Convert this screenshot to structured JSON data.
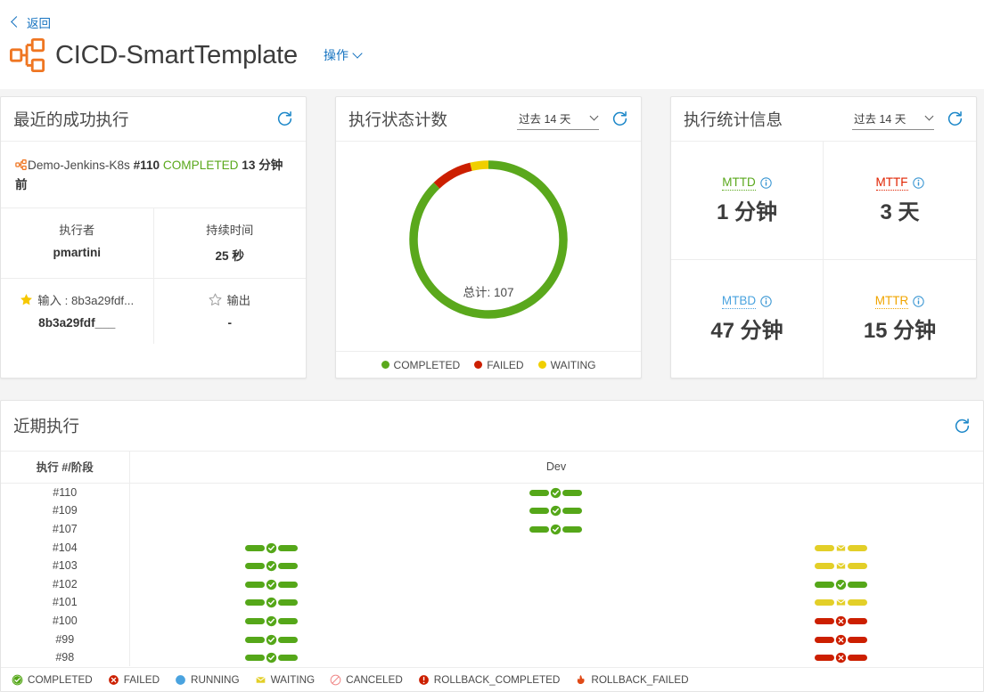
{
  "header": {
    "back_label": "返回",
    "title": "CICD-SmartTemplate",
    "actions_label": "操作",
    "logo_icon": "pipeline-template-icon"
  },
  "recent_success": {
    "title": "最近的成功执行",
    "refresh_icon": "refresh-icon",
    "pipeline_name": "Demo-Jenkins-K8s",
    "run_number": "#110",
    "status": "COMPLETED",
    "status_color": "#5aa81c",
    "time_ago": "13 分钟前",
    "executor_label": "执行者",
    "executor_value": "pmartini",
    "duration_label": "持续时间",
    "duration_value": "25 秒",
    "input_label": "输入 : 8b3a29fdf...",
    "input_value": "8b3a29fdf___",
    "input_icon": "star-filled-icon",
    "output_label": "输出",
    "output_value": "-",
    "output_icon": "star-outline-icon"
  },
  "status_counts": {
    "title": "执行状态计数",
    "range_value": "过去 14 天",
    "refresh_icon": "refresh-icon",
    "center_label": "总计: 107"
  },
  "chart_data": {
    "type": "pie",
    "title": "执行状态计数",
    "subtitle": "总计: 107",
    "total": 107,
    "categories": [
      "COMPLETED",
      "FAILED",
      "WAITING"
    ],
    "values": [
      94,
      9,
      4
    ],
    "colors": [
      "#5aa81c",
      "#cc1f00",
      "#f0cf00"
    ],
    "legend_position": "bottom",
    "donut": true,
    "grid": false
  },
  "exec_stats": {
    "title": "执行统计信息",
    "range_value": "过去 14 天",
    "refresh_icon": "refresh-icon",
    "items": [
      {
        "abbr": "MTTD",
        "value": "1 分钟",
        "color": "#5aa81c",
        "info_icon": "info-icon"
      },
      {
        "abbr": "MTTF",
        "value": "3 天",
        "color": "#e02200",
        "info_icon": "info-icon"
      },
      {
        "abbr": "MTBD",
        "value": "47 分钟",
        "color": "#4aa3df",
        "info_icon": "info-icon"
      },
      {
        "abbr": "MTTR",
        "value": "15 分钟",
        "color": "#f0a500",
        "info_icon": "info-icon"
      }
    ]
  },
  "recent_executions": {
    "title": "近期执行",
    "refresh_icon": "refresh-icon",
    "col_run_header": "执行 #/阶段",
    "stage_headers": [
      "",
      "Dev",
      ""
    ],
    "rows": [
      {
        "run": "#110",
        "stages": [
          null,
          "COMPLETED",
          null
        ]
      },
      {
        "run": "#109",
        "stages": [
          null,
          "COMPLETED",
          null
        ]
      },
      {
        "run": "#107",
        "stages": [
          null,
          "COMPLETED",
          null
        ]
      },
      {
        "run": "#104",
        "stages": [
          "COMPLETED",
          null,
          "WAITING"
        ]
      },
      {
        "run": "#103",
        "stages": [
          "COMPLETED",
          null,
          "WAITING"
        ]
      },
      {
        "run": "#102",
        "stages": [
          "COMPLETED",
          null,
          "COMPLETED"
        ]
      },
      {
        "run": "#101",
        "stages": [
          "COMPLETED",
          null,
          "WAITING"
        ]
      },
      {
        "run": "#100",
        "stages": [
          "COMPLETED",
          null,
          "FAILED"
        ]
      },
      {
        "run": "#99",
        "stages": [
          "COMPLETED",
          null,
          "FAILED"
        ]
      },
      {
        "run": "#98",
        "stages": [
          "COMPLETED",
          null,
          "FAILED"
        ]
      }
    ],
    "legend": [
      {
        "label": "COMPLETED",
        "icon": "check-circle-icon",
        "color": "#5aa81c"
      },
      {
        "label": "FAILED",
        "icon": "x-circle-icon",
        "color": "#cc1f00"
      },
      {
        "label": "RUNNING",
        "icon": "circle-icon",
        "color": "#4aa3df"
      },
      {
        "label": "WAITING",
        "icon": "envelope-icon",
        "color": "#e8cf22"
      },
      {
        "label": "CANCELED",
        "icon": "no-entry-icon",
        "color": "#f08a8a"
      },
      {
        "label": "ROLLBACK_COMPLETED",
        "icon": "exclamation-circle-icon",
        "color": "#cc1f00"
      },
      {
        "label": "ROLLBACK_FAILED",
        "icon": "flame-icon",
        "color": "#e04a17"
      }
    ]
  }
}
